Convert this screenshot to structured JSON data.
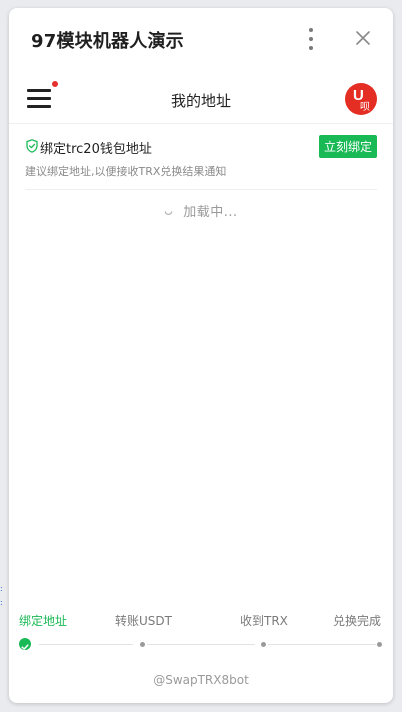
{
  "window": {
    "title": "97模块机器人演示"
  },
  "appbar": {
    "title": "我的地址",
    "avatar_letter": "U",
    "avatar_sub": "呗"
  },
  "bind_card": {
    "title": "绑定trc20钱包地址",
    "button_label": "立刻绑定",
    "tip": "建议绑定地址,以便接收TRX兑换结果通知"
  },
  "loading": {
    "text": "加载中..."
  },
  "steps": [
    {
      "label": "绑定地址",
      "state": "done"
    },
    {
      "label": "转账USDT",
      "state": "pending"
    },
    {
      "label": "收到TRX",
      "state": "pending"
    },
    {
      "label": "兑换完成",
      "state": "pending"
    }
  ],
  "footer": {
    "handle": "@SwapTRX8bot"
  },
  "colors": {
    "accent_green": "#19b955",
    "avatar_red": "#e42e23",
    "notify_red": "#e5312d"
  },
  "icons": [
    "more-vertical-icon",
    "close-icon",
    "hamburger-menu-icon",
    "shield-check-icon",
    "spinner-icon",
    "check-circle-icon"
  ]
}
